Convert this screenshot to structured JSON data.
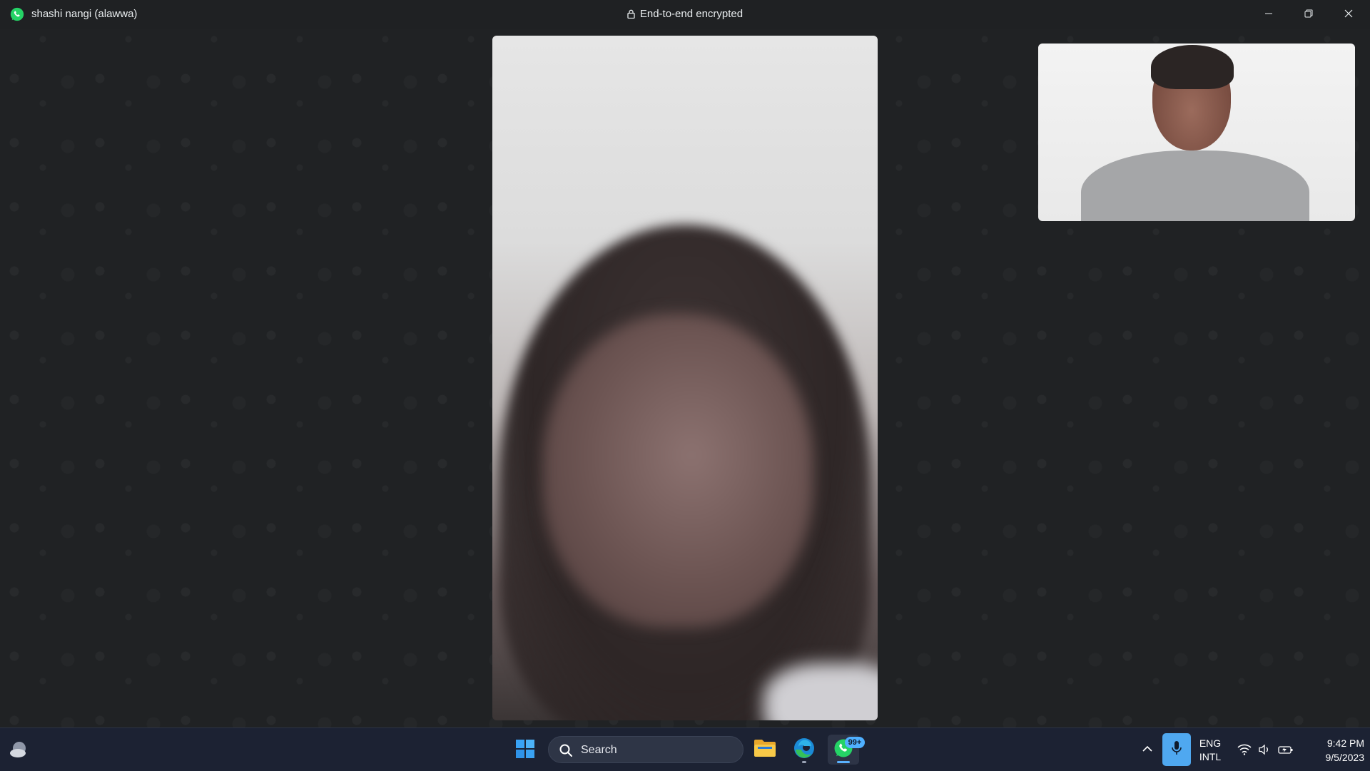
{
  "window": {
    "contact_name": "shashi nangi (alawwa)",
    "encryption_text": "End-to-end encrypted",
    "app_icon": "whatsapp-icon",
    "controls": [
      "minimize-icon",
      "restore-icon",
      "close-icon"
    ]
  },
  "call": {
    "remote_video_label": "remote-video",
    "self_video_label": "self-video"
  },
  "taskbar": {
    "search_label": "Search",
    "pinned_apps": [
      "file-explorer",
      "edge",
      "whatsapp"
    ],
    "whatsapp_badge": "99+",
    "language": {
      "line1": "ENG",
      "line2": "INTL"
    },
    "time": "9:42 PM",
    "date": "9/5/2023"
  },
  "colors": {
    "whatsapp_green": "#25d366",
    "taskbar_bg": "#1c2233",
    "accent_blue": "#4fa8f0"
  }
}
